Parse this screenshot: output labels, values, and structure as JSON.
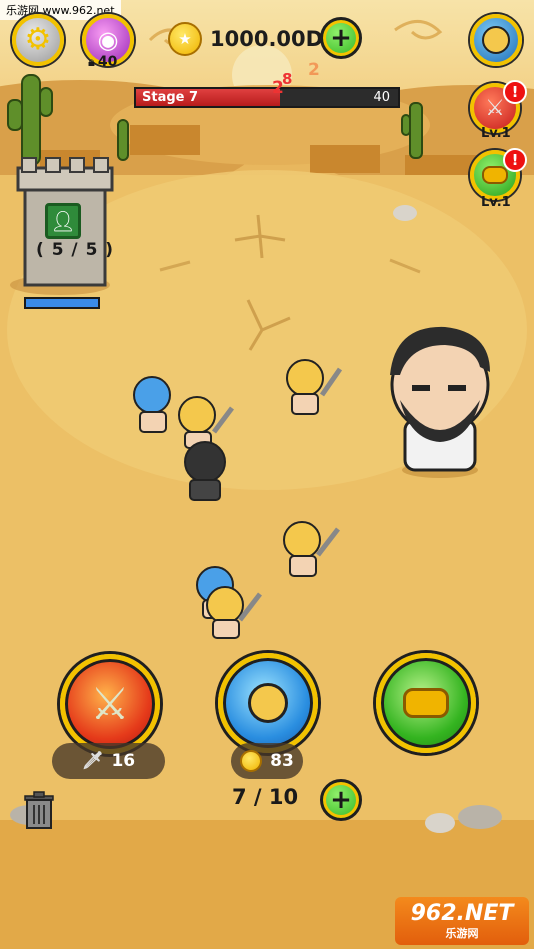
{
  "watermark": {
    "text": "乐游网 www.962.net"
  },
  "hud": {
    "eye_lock_count": "40",
    "currency": "1000.00D",
    "stage": {
      "label": "Stage 7",
      "value": "40",
      "progress": 0.55
    },
    "damage_numbers": [
      "2",
      "8",
      "2"
    ]
  },
  "side_buttons": [
    {
      "name": "weapon-upgrade",
      "level": "Lv.1",
      "alert": "!"
    },
    {
      "name": "gold-upgrade",
      "level": "Lv.1",
      "alert": "!"
    }
  ],
  "tower": {
    "count": "( 5 / 5 )",
    "hp": 1.0
  },
  "bottom": {
    "weapon_cost": "16",
    "summon_cost": "83",
    "unit_count": "7 / 10"
  },
  "logo": {
    "main": "962.NET",
    "sub": "乐游网"
  },
  "colors": {
    "gold_ring": "#f2c200",
    "hp_bar": "#3a8be8",
    "stage_bar": "#c62828"
  }
}
